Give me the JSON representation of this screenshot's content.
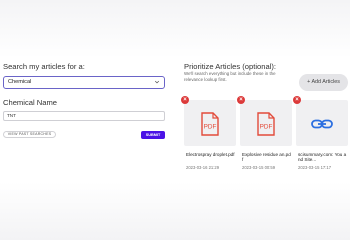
{
  "search": {
    "heading": "Search my articles for a:",
    "selected_type": "Chemical",
    "name_label": "Chemical Name",
    "name_value": "TNT",
    "past_searches_label": "VIEW PAST SEARCHES",
    "submit_label": "SUBMIT"
  },
  "prioritize": {
    "heading": "Prioritize Articles (optional):",
    "subtext_line1": "We'll search everything but include these in the",
    "subtext_line2": "relevance lookup first.",
    "add_label": "+ Add Articles",
    "remove_glyph": "×",
    "articles": [
      {
        "title": "Electrospray droplet.pdf",
        "date": "2023-03-16 21:29",
        "icon": "pdf-icon"
      },
      {
        "title": "Explosive residue an.pdf",
        "date": "2023-03-15 00:59",
        "icon": "pdf-icon"
      },
      {
        "title": "scisummary.com: You and Site...",
        "date": "2023-03-15 17:17",
        "icon": "link-icon"
      }
    ]
  },
  "colors": {
    "accent": "#4b12e6",
    "select_border": "#6a64c8",
    "remove_red": "#dc3a3a",
    "pdf_red": "#e24b3b",
    "link_blue": "#2c6fe0"
  }
}
